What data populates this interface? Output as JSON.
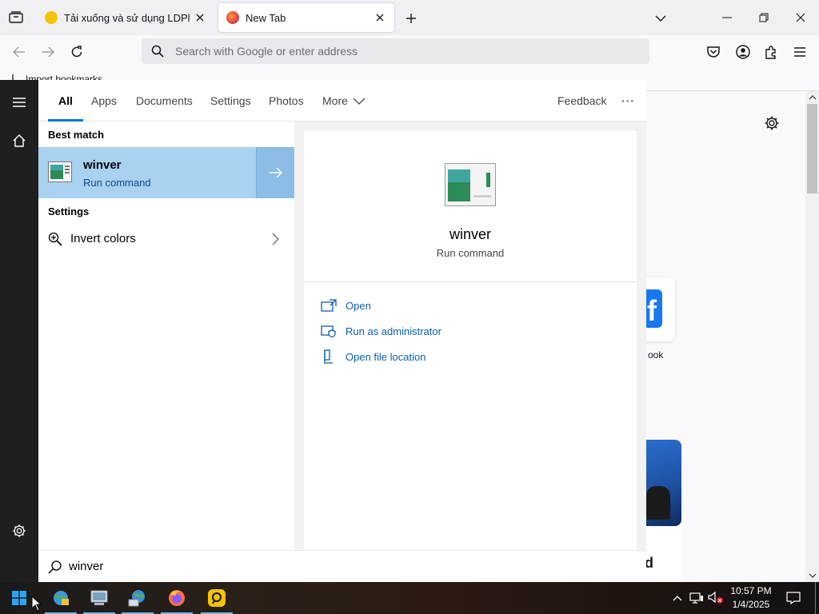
{
  "browser": {
    "tabs": [
      {
        "title": "Tải xuống và sử dụng LDPlayer",
        "active": false
      },
      {
        "title": "New Tab",
        "active": true
      }
    ],
    "address_placeholder": "Search with Google or enter address",
    "bookmarks_toolbar": {
      "import_label": "Import bookmarks..."
    },
    "new_tab_page": {
      "shortcut_label": "ook",
      "story_letter": "d"
    }
  },
  "start_search": {
    "filters": [
      "All",
      "Apps",
      "Documents",
      "Settings",
      "Photos",
      "More"
    ],
    "active_filter": "All",
    "feedback_label": "Feedback",
    "more_options_label": "···",
    "best_match_heading": "Best match",
    "best_match": {
      "name": "winver",
      "type": "Run command"
    },
    "settings_heading": "Settings",
    "settings_results": [
      {
        "label": "Invert colors"
      }
    ],
    "detail": {
      "name": "winver",
      "type": "Run command",
      "actions": [
        {
          "label": "Open",
          "icon": "open-icon"
        },
        {
          "label": "Run as administrator",
          "icon": "shield-admin-icon"
        },
        {
          "label": "Open file location",
          "icon": "folder-location-icon"
        }
      ]
    },
    "query": "winver"
  },
  "taskbar": {
    "apps": [
      {
        "name": "explorer-globe-app",
        "running": true
      },
      {
        "name": "computer-app",
        "running": true
      },
      {
        "name": "network-app",
        "running": true
      },
      {
        "name": "firefox-app",
        "running": true
      },
      {
        "name": "ldplayer-app",
        "running": true
      }
    ],
    "clock": {
      "time": "10:57 PM",
      "date": "1/4/2025"
    }
  },
  "colors": {
    "accent": "#0078d7",
    "best_match_bg": "#a9d1f0",
    "link": "#0a5fad",
    "start_rail": "#1f1f1f"
  }
}
